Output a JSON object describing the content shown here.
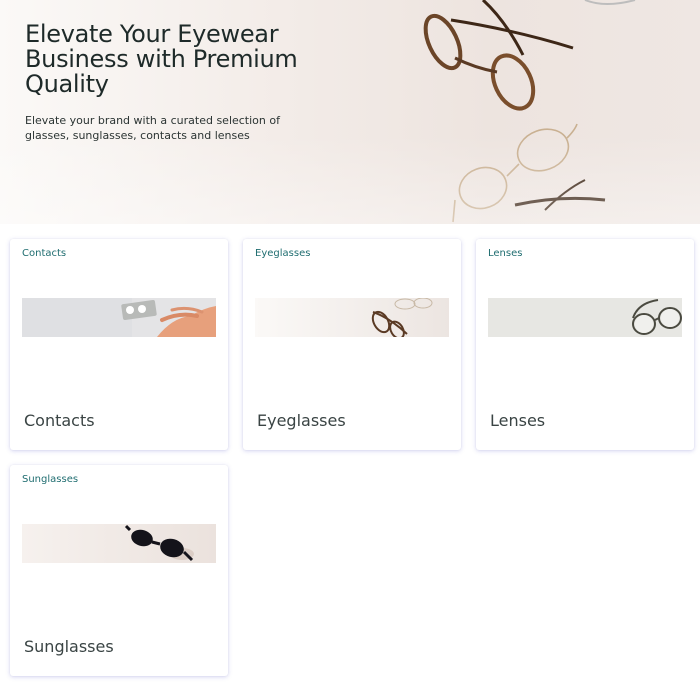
{
  "hero": {
    "title": "Elevate Your Eyewear Business with Premium Quality",
    "subtitle": "Elevate your brand with a curated selection of glasses, sunglasses, contacts and lenses"
  },
  "categories": [
    {
      "tag": "Contacts",
      "title": "Contacts",
      "image": "contacts-photo"
    },
    {
      "tag": "Eyeglasses",
      "title": "Eyeglasses",
      "image": "eyeglasses-photo"
    },
    {
      "tag": "Lenses",
      "title": "Lenses",
      "image": "lenses-photo"
    },
    {
      "tag": "Sunglasses",
      "title": "Sunglasses",
      "image": "sunglasses-photo"
    }
  ],
  "colors": {
    "tag_text": "#1f6d70",
    "card_title": "#3a4444",
    "heading": "#1e2a29"
  }
}
